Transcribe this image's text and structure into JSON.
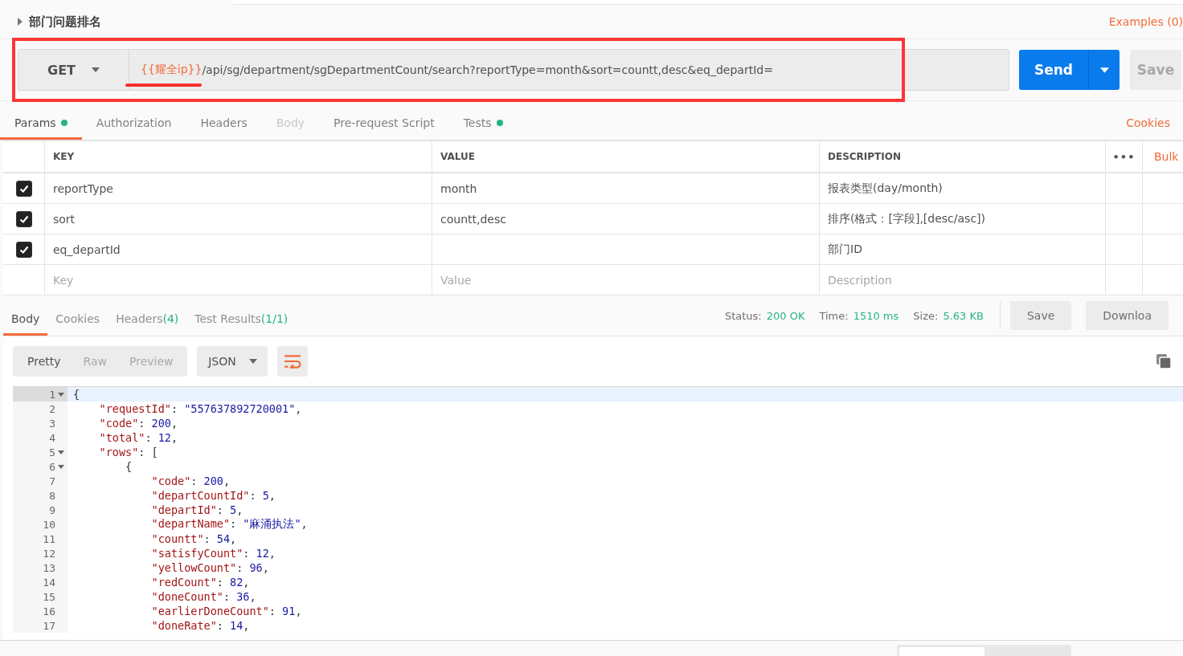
{
  "request": {
    "name": "部门问题排名",
    "examples": "Examples (0)",
    "method": "GET",
    "url_variable": "{{耀全ip}}",
    "url_rest": "/api/sg/department/sgDepartmentCount/search?reportType=month&sort=countt,desc&eq_departId=",
    "send": "Send",
    "save": "Save"
  },
  "request_tabs": [
    {
      "label": "Params",
      "selected": true,
      "disabled": false,
      "dot": true
    },
    {
      "label": "Authorization",
      "selected": false,
      "disabled": false,
      "dot": false
    },
    {
      "label": "Headers",
      "selected": false,
      "disabled": false,
      "dot": false
    },
    {
      "label": "Body",
      "selected": false,
      "disabled": true,
      "dot": false
    },
    {
      "label": "Pre-request Script",
      "selected": false,
      "disabled": false,
      "dot": false
    },
    {
      "label": "Tests",
      "selected": false,
      "disabled": false,
      "dot": true
    }
  ],
  "cookies_link": "Cookies",
  "params": {
    "columns": [
      "KEY",
      "VALUE",
      "DESCRIPTION"
    ],
    "more": "•••",
    "bulk": "Bulk",
    "rows": [
      {
        "checked": true,
        "key": "reportType",
        "value": "month",
        "description": "报表类型(day/month)"
      },
      {
        "checked": true,
        "key": "sort",
        "value": "countt,desc",
        "description": "排序(格式：[字段],[desc/asc])"
      },
      {
        "checked": true,
        "key": "eq_departId",
        "description": "部门ID"
      }
    ],
    "new_row": {
      "key_placeholder": "Key",
      "value_placeholder": "Value",
      "description_placeholder": "Description"
    }
  },
  "response_tabs": [
    {
      "label": "Body",
      "selected": true
    },
    {
      "label": "Cookies",
      "selected": false
    },
    {
      "label": "Headers",
      "count": "(4)",
      "selected": false
    },
    {
      "label": "Test Results",
      "count": "(1/1)",
      "selected": false
    }
  ],
  "status": [
    {
      "label": "Status:",
      "value": "200 OK"
    },
    {
      "label": "Time:",
      "value": "1510 ms"
    },
    {
      "label": "Size:",
      "value": "5.63 KB"
    }
  ],
  "response_buttons": [
    "Save",
    "Downloa"
  ],
  "view_modes": [
    {
      "label": "Pretty",
      "selected": true
    },
    {
      "label": "Raw",
      "selected": false
    },
    {
      "label": "Preview",
      "selected": false
    }
  ],
  "format": "JSON",
  "code_lines": [
    {
      "number": "1",
      "fold": true,
      "current": true,
      "tokens": [
        {
          "kind": "punct",
          "text": "{"
        }
      ]
    },
    {
      "number": "2",
      "fold": false,
      "current": false,
      "tokens": [
        {
          "kind": "key",
          "text": "    \"requestId\""
        },
        {
          "kind": "punct",
          "text": ": "
        },
        {
          "kind": "string",
          "text": "\"557637892720001\""
        },
        {
          "kind": "punct",
          "text": ","
        }
      ]
    },
    {
      "number": "3",
      "fold": false,
      "current": false,
      "tokens": [
        {
          "kind": "key",
          "text": "    \"code\""
        },
        {
          "kind": "punct",
          "text": ": "
        },
        {
          "kind": "number",
          "text": "200"
        },
        {
          "kind": "punct",
          "text": ","
        }
      ]
    },
    {
      "number": "4",
      "fold": false,
      "current": false,
      "tokens": [
        {
          "kind": "key",
          "text": "    \"total\""
        },
        {
          "kind": "punct",
          "text": ": "
        },
        {
          "kind": "number",
          "text": "12"
        },
        {
          "kind": "punct",
          "text": ","
        }
      ]
    },
    {
      "number": "5",
      "fold": true,
      "current": false,
      "tokens": [
        {
          "kind": "key",
          "text": "    \"rows\""
        },
        {
          "kind": "punct",
          "text": ": ["
        }
      ]
    },
    {
      "number": "6",
      "fold": true,
      "current": false,
      "tokens": [
        {
          "kind": "punct",
          "text": "        {"
        }
      ]
    },
    {
      "number": "7",
      "fold": false,
      "current": false,
      "tokens": [
        {
          "kind": "key",
          "text": "            \"code\""
        },
        {
          "kind": "punct",
          "text": ": "
        },
        {
          "kind": "number",
          "text": "200"
        },
        {
          "kind": "punct",
          "text": ","
        }
      ]
    },
    {
      "number": "8",
      "fold": false,
      "current": false,
      "tokens": [
        {
          "kind": "key",
          "text": "            \"departCountId\""
        },
        {
          "kind": "punct",
          "text": ": "
        },
        {
          "kind": "number",
          "text": "5"
        },
        {
          "kind": "punct",
          "text": ","
        }
      ]
    },
    {
      "number": "9",
      "fold": false,
      "current": false,
      "tokens": [
        {
          "kind": "key",
          "text": "            \"departId\""
        },
        {
          "kind": "punct",
          "text": ": "
        },
        {
          "kind": "number",
          "text": "5"
        },
        {
          "kind": "punct",
          "text": ","
        }
      ]
    },
    {
      "number": "10",
      "fold": false,
      "current": false,
      "tokens": [
        {
          "kind": "key",
          "text": "            \"departName\""
        },
        {
          "kind": "punct",
          "text": ": "
        },
        {
          "kind": "string",
          "text": "\"麻涌执法\""
        },
        {
          "kind": "punct",
          "text": ","
        }
      ]
    },
    {
      "number": "11",
      "fold": false,
      "current": false,
      "tokens": [
        {
          "kind": "key",
          "text": "            \"countt\""
        },
        {
          "kind": "punct",
          "text": ": "
        },
        {
          "kind": "number",
          "text": "54"
        },
        {
          "kind": "punct",
          "text": ","
        }
      ]
    },
    {
      "number": "12",
      "fold": false,
      "current": false,
      "tokens": [
        {
          "kind": "key",
          "text": "            \"satisfyCount\""
        },
        {
          "kind": "punct",
          "text": ": "
        },
        {
          "kind": "number",
          "text": "12"
        },
        {
          "kind": "punct",
          "text": ","
        }
      ]
    },
    {
      "number": "13",
      "fold": false,
      "current": false,
      "tokens": [
        {
          "kind": "key",
          "text": "            \"yellowCount\""
        },
        {
          "kind": "punct",
          "text": ": "
        },
        {
          "kind": "number",
          "text": "96"
        },
        {
          "kind": "punct",
          "text": ","
        }
      ]
    },
    {
      "number": "14",
      "fold": false,
      "current": false,
      "tokens": [
        {
          "kind": "key",
          "text": "            \"redCount\""
        },
        {
          "kind": "punct",
          "text": ": "
        },
        {
          "kind": "number",
          "text": "82"
        },
        {
          "kind": "punct",
          "text": ","
        }
      ]
    },
    {
      "number": "15",
      "fold": false,
      "current": false,
      "tokens": [
        {
          "kind": "key",
          "text": "            \"doneCount\""
        },
        {
          "kind": "punct",
          "text": ": "
        },
        {
          "kind": "number",
          "text": "36"
        },
        {
          "kind": "punct",
          "text": ","
        }
      ]
    },
    {
      "number": "16",
      "fold": false,
      "current": false,
      "tokens": [
        {
          "kind": "key",
          "text": "            \"earlierDoneCount\""
        },
        {
          "kind": "punct",
          "text": ": "
        },
        {
          "kind": "number",
          "text": "91"
        },
        {
          "kind": "punct",
          "text": ","
        }
      ]
    },
    {
      "number": "17",
      "fold": false,
      "current": false,
      "tokens": [
        {
          "kind": "key",
          "text": "            \"doneRate\""
        },
        {
          "kind": "punct",
          "text": ": "
        },
        {
          "kind": "number",
          "text": "14"
        },
        {
          "kind": "punct",
          "text": ","
        }
      ]
    }
  ]
}
